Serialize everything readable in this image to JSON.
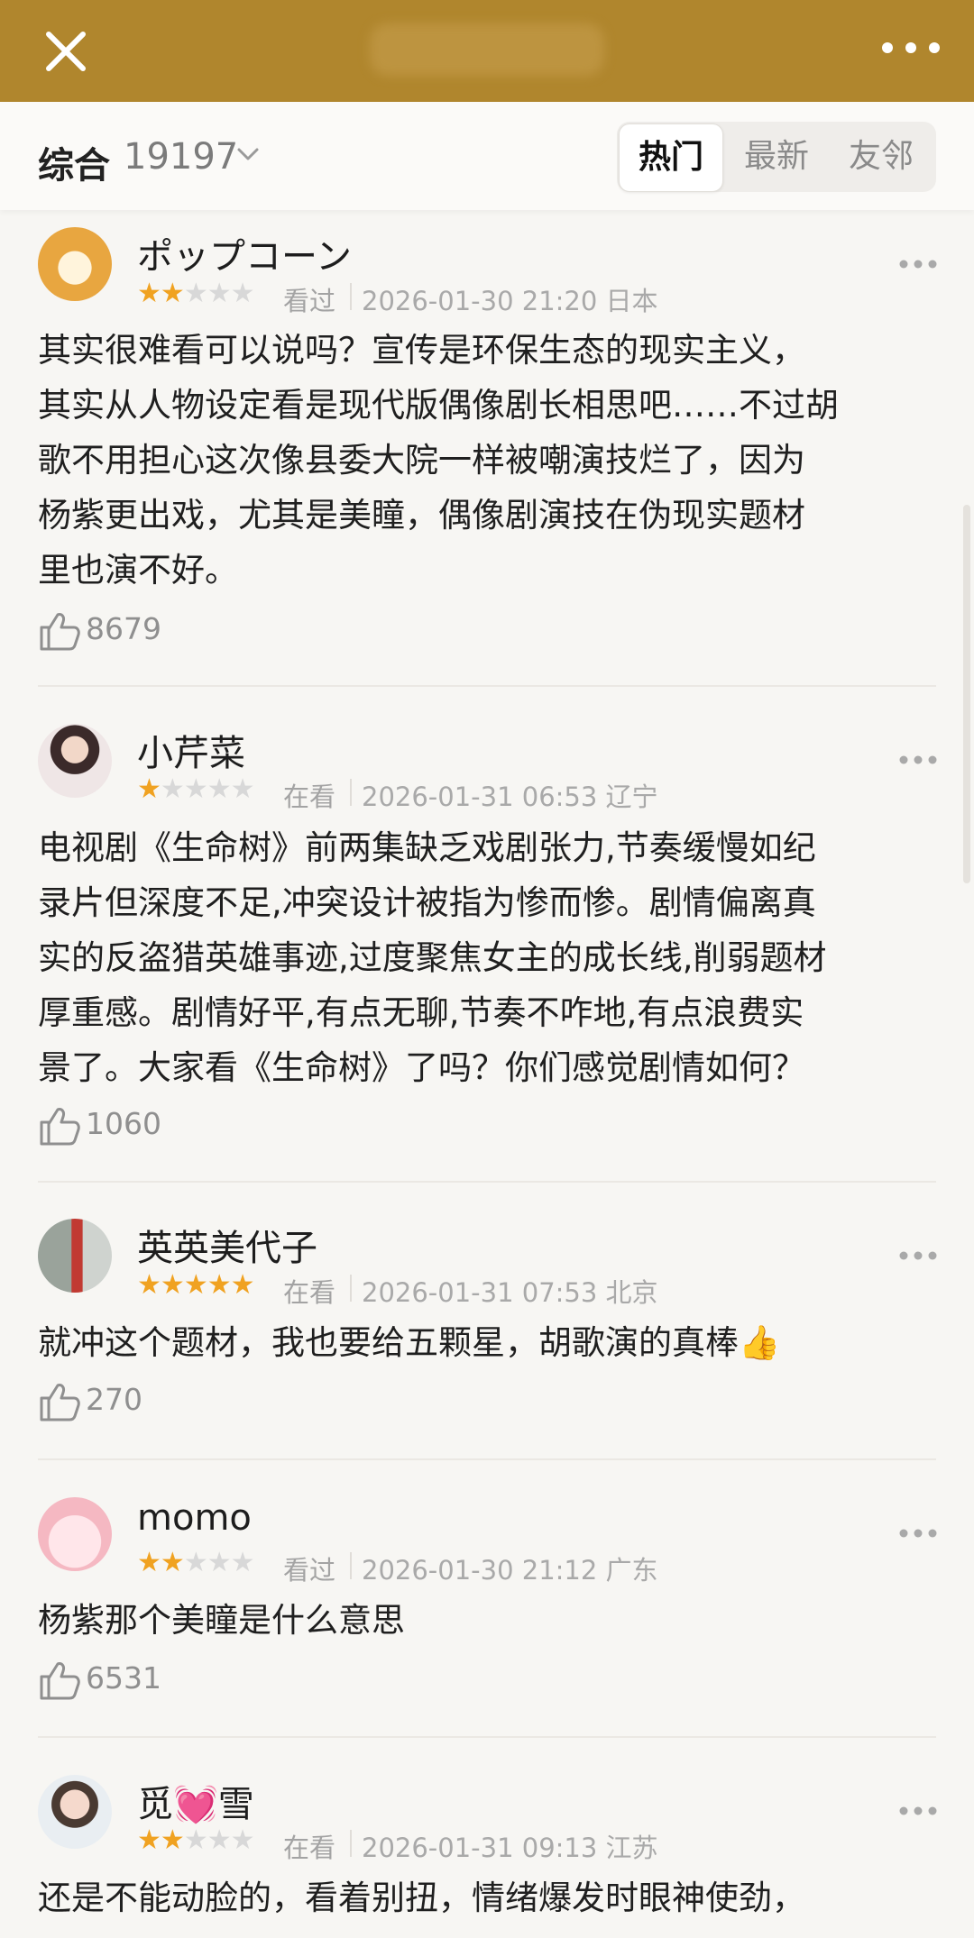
{
  "topbar": {
    "close_icon": "close-icon",
    "more_icon": "more-horizontal-icon",
    "color": "#b0862d"
  },
  "filter": {
    "sort_label": "综合",
    "count": "19197",
    "tabs": [
      "热门",
      "最新",
      "友邻"
    ],
    "active_tab": "热门"
  },
  "reviews": [
    {
      "username": "ポップコーン",
      "rating": 2,
      "status": "看过",
      "time": "2026-01-30 21:20 日本",
      "lines": [
        "其实很难看可以说吗？宣传是环保生态的现实主义，",
        "其实从人物设定看是现代版偶像剧长相思吧……不过胡",
        "歌不用担心这次像县委大院一样被嘲演技烂了，因为",
        "杨紫更出戏，尤其是美瞳，偶像剧演技在伪现实题材",
        "里也演不好。"
      ],
      "likes": "8679"
    },
    {
      "username": "小芹菜",
      "rating": 1,
      "status": "在看",
      "time": "2026-01-31 06:53 辽宁",
      "lines": [
        "电视剧《生命树》前两集缺乏戏剧张力,节奏缓慢如纪",
        "录片但深度不足,冲突设计被指为惨而惨。剧情偏离真",
        "实的反盗猎英雄事迹,过度聚焦女主的成长线,削弱题材",
        "厚重感。剧情好平,有点无聊,节奏不咋地,有点浪费实",
        "景了。大家看《生命树》了吗？你们感觉剧情如何？"
      ],
      "likes": "1060"
    },
    {
      "username": "英英美代子",
      "rating": 5,
      "status": "在看",
      "time": "2026-01-31 07:53 北京",
      "lines": [
        "就冲这个题材，我也要给五颗星，胡歌演的真棒👍"
      ],
      "likes": "270"
    },
    {
      "username": "momo",
      "rating": 2,
      "status": "看过",
      "time": "2026-01-30 21:12 广东",
      "lines": [
        "杨紫那个美瞳是什么意思"
      ],
      "likes": "6531"
    },
    {
      "username": "觅💓雪",
      "rating": 2,
      "status": "在看",
      "time": "2026-01-31 09:13 江苏",
      "lines": [
        "还是不能动脸的，看着别扭，情绪爆发时眼神使劲，"
      ],
      "likes": ""
    }
  ],
  "colors": {
    "star_on": "#f0a221",
    "star_off": "#d8d8d8"
  }
}
